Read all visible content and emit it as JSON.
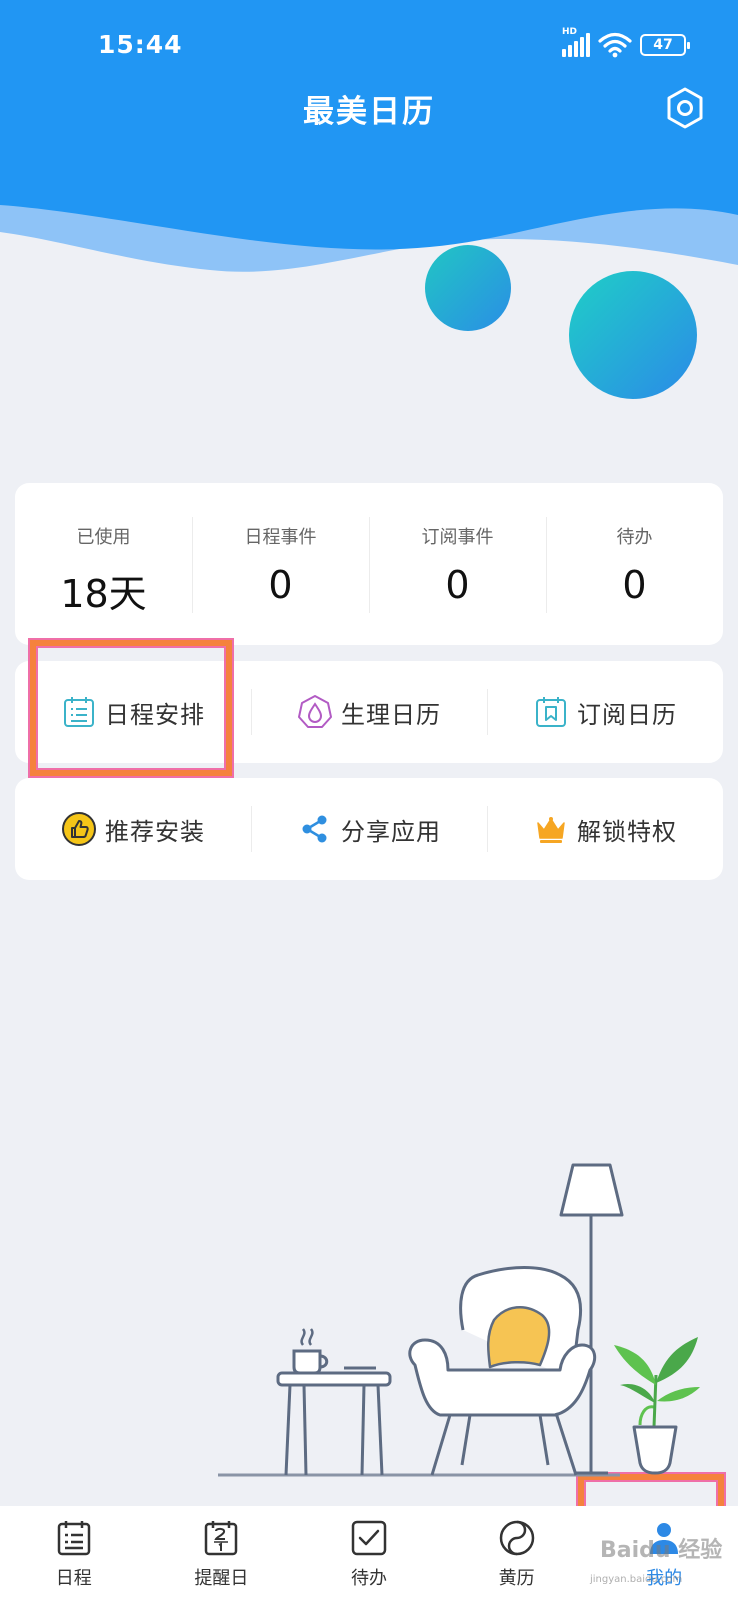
{
  "status_bar": {
    "time": "15:44",
    "network": "HD",
    "battery": "47"
  },
  "header": {
    "title": "最美日历"
  },
  "stats": [
    {
      "label": "已使用",
      "value": "18天"
    },
    {
      "label": "日程事件",
      "value": "0"
    },
    {
      "label": "订阅事件",
      "value": "0"
    },
    {
      "label": "待办",
      "value": "0"
    }
  ],
  "menu_row1": [
    {
      "label": "日程安排",
      "icon": "schedule-icon"
    },
    {
      "label": "生理日历",
      "icon": "period-icon"
    },
    {
      "label": "订阅日历",
      "icon": "subscribe-icon"
    }
  ],
  "menu_row2": [
    {
      "label": "推荐安装",
      "icon": "thumbs-up-icon"
    },
    {
      "label": "分享应用",
      "icon": "share-icon"
    },
    {
      "label": "解锁特权",
      "icon": "crown-icon"
    }
  ],
  "tabs": [
    {
      "label": "日程",
      "icon": "schedule-icon"
    },
    {
      "label": "提醒日",
      "icon": "calendar-date-icon"
    },
    {
      "label": "待办",
      "icon": "checkbox-icon"
    },
    {
      "label": "黄历",
      "icon": "yin-yang-icon"
    },
    {
      "label": "我的",
      "icon": "profile-icon",
      "active": true
    }
  ],
  "watermark": {
    "text": "Baidu 经验",
    "sub": "jingyan.baidu.com"
  },
  "colors": {
    "primary": "#2d89e5",
    "header": "#2196f3",
    "highlight": "#f5823d",
    "background": "#eef0f5"
  }
}
